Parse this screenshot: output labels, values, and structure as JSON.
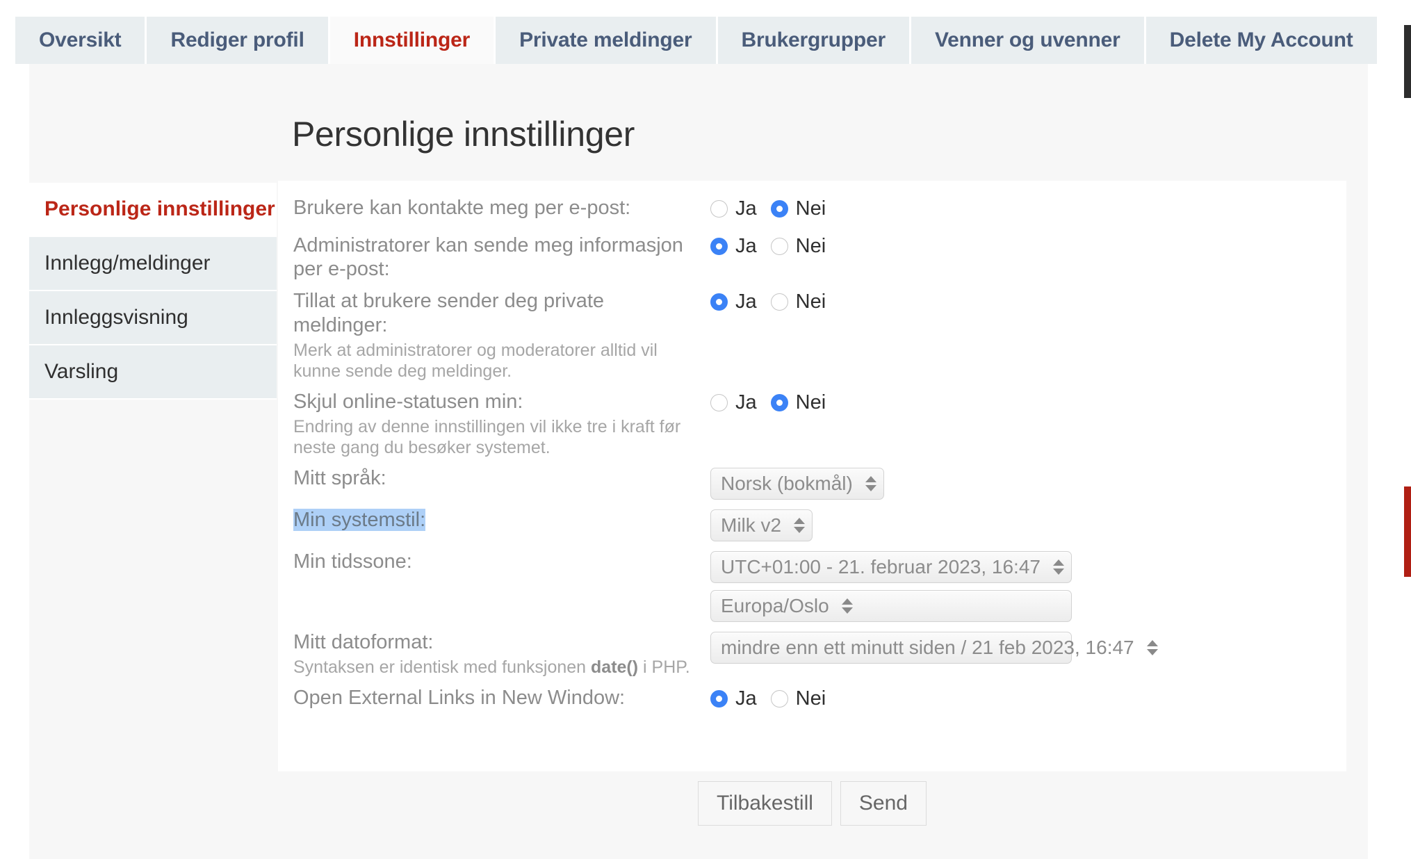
{
  "nav": {
    "tabs": [
      {
        "label": "Oversikt",
        "active": false
      },
      {
        "label": "Rediger profil",
        "active": false
      },
      {
        "label": "Innstillinger",
        "active": true
      },
      {
        "label": "Private meldinger",
        "active": false
      },
      {
        "label": "Brukergrupper",
        "active": false
      },
      {
        "label": "Venner og uvenner",
        "active": false
      },
      {
        "label": "Delete My Account",
        "active": false
      }
    ]
  },
  "page": {
    "title": "Personlige innstillinger"
  },
  "sidemenu": {
    "items": [
      {
        "label": "Personlige innstillinger",
        "active": true
      },
      {
        "label": "Innlegg/meldinger",
        "active": false
      },
      {
        "label": "Innleggsvisning",
        "active": false
      },
      {
        "label": "Varsling",
        "active": false
      }
    ]
  },
  "radio_labels": {
    "yes": "Ja",
    "no": "Nei"
  },
  "form": {
    "contact_email": {
      "label": "Brukere kan kontakte meg per e-post:",
      "value": "no"
    },
    "admin_email": {
      "label": "Administratorer kan sende meg informasjon per e-post:",
      "value": "yes"
    },
    "allow_pm": {
      "label": "Tillat at brukere sender deg private meldinger:",
      "hint": "Merk at administratorer og moderatorer alltid vil kunne sende deg meldinger.",
      "value": "yes"
    },
    "hide_online": {
      "label": "Skjul online-statusen min:",
      "hint": "Endring av denne innstillingen vil ikke tre i kraft før neste gang du besøker systemet.",
      "value": "no"
    },
    "language": {
      "label": "Mitt språk:",
      "value": "Norsk (bokmål)"
    },
    "style": {
      "label": "Min systemstil:",
      "value": "Milk v2",
      "label_selected": true
    },
    "timezone": {
      "label": "Min tidssone:",
      "offset_value": "UTC+01:00 - 21. februar 2023, 16:47",
      "region_value": "Europa/Oslo"
    },
    "dateformat": {
      "label": "Mitt datoformat:",
      "hint_pre": "Syntaksen er identisk med funksjonen ",
      "hint_code": "date()",
      "hint_post": " i PHP.",
      "value": "mindre enn ett minutt siden / 21 feb 2023, 16:47"
    },
    "external_links": {
      "label": "Open External Links in New Window:",
      "value": "yes"
    }
  },
  "footer": {
    "reset_label": "Tilbakestill",
    "submit_label": "Send"
  },
  "colors": {
    "accent_red": "#bb2617",
    "tab_text": "#4a5c7a",
    "tab_bg": "#e9eef0",
    "radio_on": "#3b82f6",
    "selection_highlight": "#aed0f7",
    "page_bg": "#f7f7f7"
  }
}
